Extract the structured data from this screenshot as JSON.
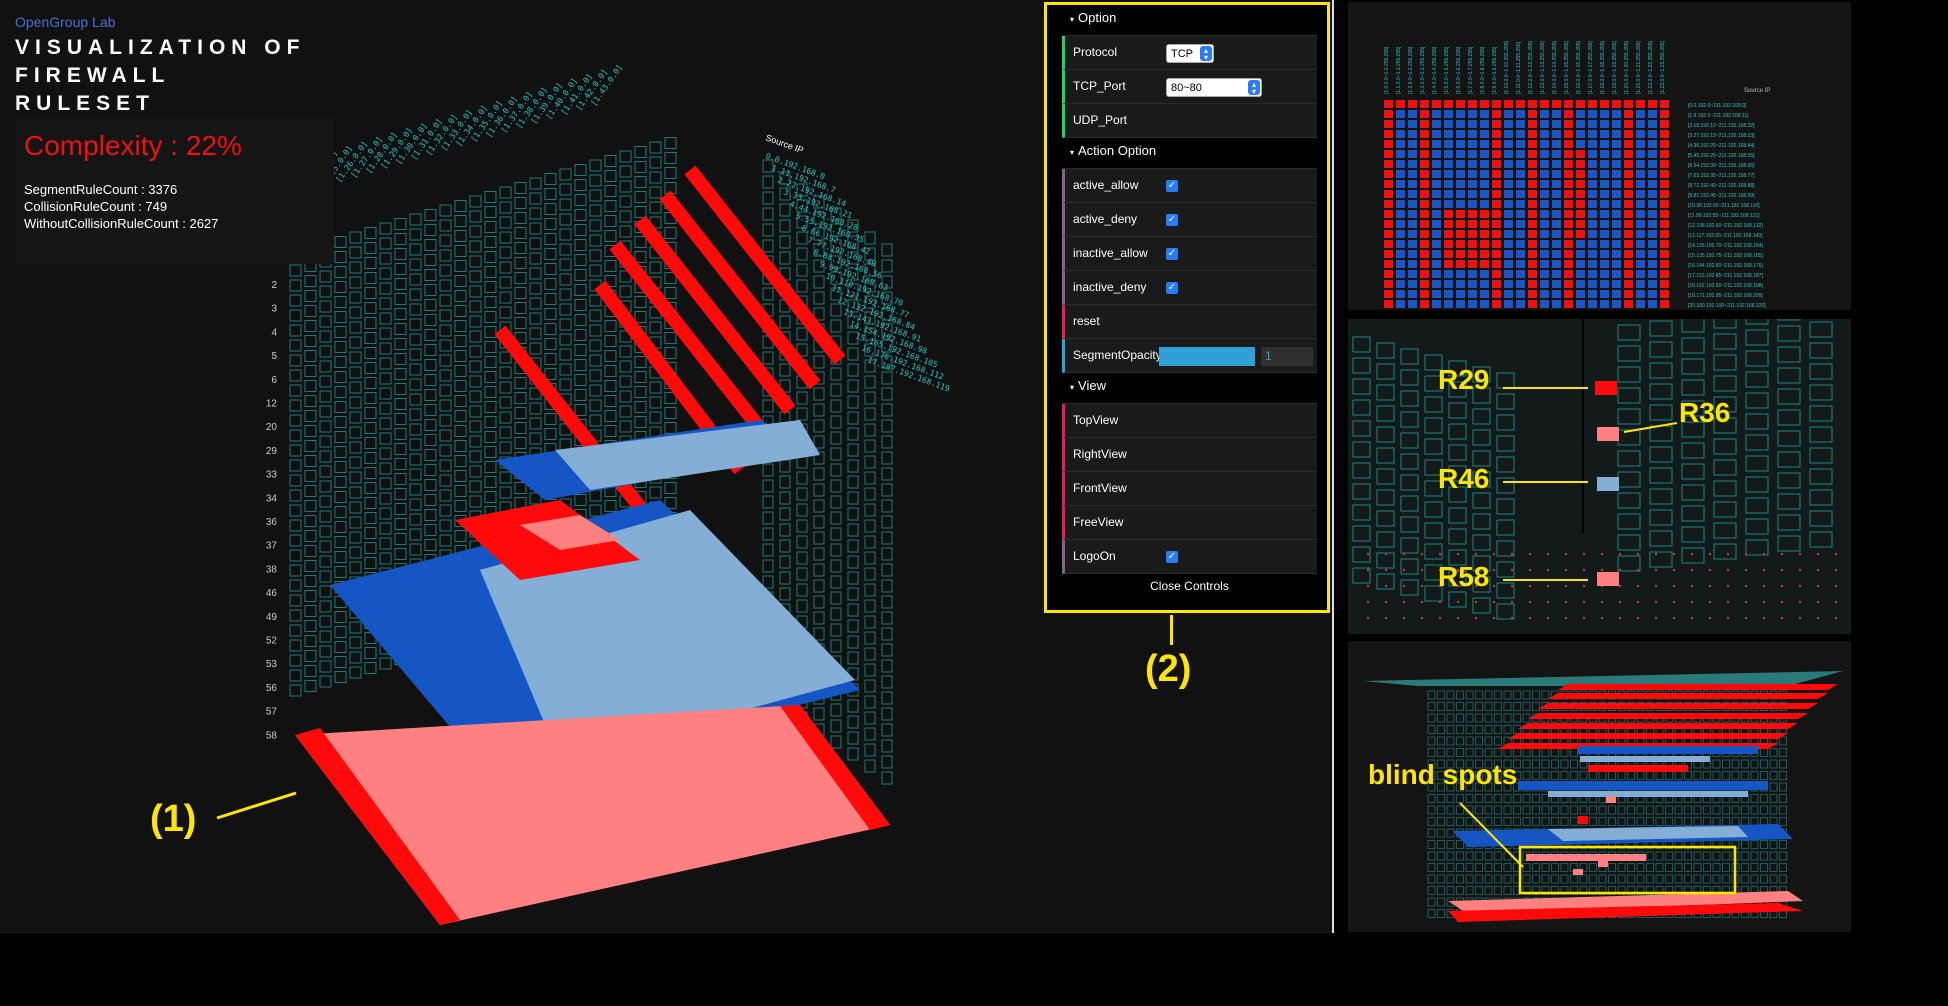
{
  "app": {
    "brand": "OpenGroup Lab",
    "title": "VISUALIZATION OF FIREWALL RULESET"
  },
  "stats": {
    "complexity": "Complexity : 22%",
    "segment": "SegmentRuleCount : 3376",
    "collision": "CollisionRuleCount : 749",
    "without_collision": "WithoutCollisionRuleCount : 2627"
  },
  "axis": {
    "source_label": "Source IP",
    "rule_ticks": [
      "2",
      "3",
      "4",
      "5",
      "6",
      "12",
      "20",
      "29",
      "33",
      "34",
      "36",
      "37",
      "38",
      "46",
      "49",
      "52",
      "53",
      "56",
      "57",
      "58"
    ]
  },
  "controls": {
    "option_header": "Option",
    "protocol_label": "Protocol",
    "protocol_value": "TCP",
    "tcp_port_label": "TCP_Port",
    "tcp_port_value": "80~80",
    "udp_port_label": "UDP_Port",
    "action_header": "Action Option",
    "active_allow": "active_allow",
    "active_deny": "active_deny",
    "inactive_allow": "inactive_allow",
    "inactive_deny": "inactive_deny",
    "reset": "reset",
    "segment_opacity_label": "SegmentOpacity",
    "segment_opacity_value": "1",
    "view_header": "View",
    "top_view": "TopView",
    "right_view": "RightView",
    "front_view": "FrontView",
    "free_view": "FreeView",
    "logo_on": "LogoOn",
    "close": "Close Controls",
    "checked": {
      "active_allow": true,
      "active_deny": true,
      "inactive_allow": true,
      "inactive_deny": true,
      "logo_on": true
    }
  },
  "annotations": {
    "one": "(1)",
    "two": "(2)",
    "r29": "R29",
    "r36": "R36",
    "r46": "R46",
    "r58": "R58",
    "blind_spots": "blind spots"
  },
  "colors": {
    "deny_active": "#ff0a0a",
    "deny_inactive": "#ff8080",
    "allow_active": "#1556c4",
    "allow_inactive": "#84aed6",
    "grid": "#1f9a9a",
    "highlight": "#ffe600"
  }
}
